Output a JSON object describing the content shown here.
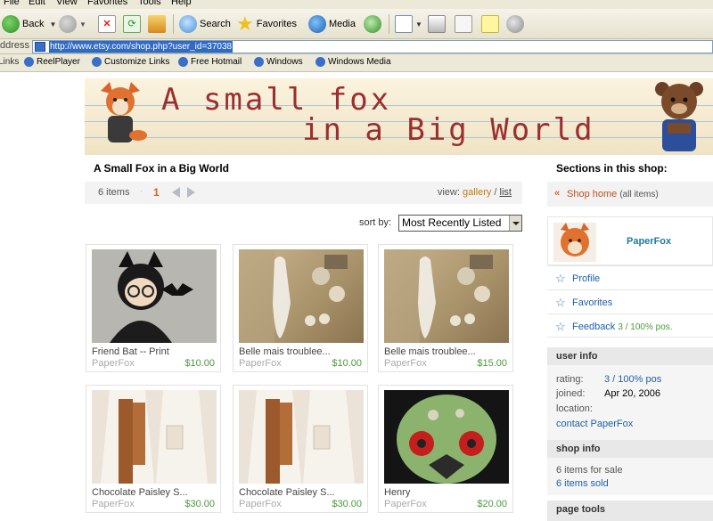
{
  "browser": {
    "menu": [
      "File",
      "Edit",
      "View",
      "Favorites",
      "Tools",
      "Help"
    ],
    "toolbar": {
      "back": "Back",
      "search": "Search",
      "favorites": "Favorites",
      "media": "Media"
    },
    "address_label": "ddress",
    "url": "http://www.etsy.com/shop.php?user_id=37038",
    "links_label": "Links",
    "links": [
      "ReelPlayer",
      "Customize Links",
      "Free Hotmail",
      "Windows",
      "Windows Media"
    ]
  },
  "banner": {
    "line1": "A small fox",
    "line2": "in a Big World"
  },
  "shop": {
    "title": "A Small Fox in a Big World",
    "items_count": "6 items",
    "page_current": "1",
    "view_label": "view:",
    "view_gallery": "gallery",
    "view_sep": "/",
    "view_list": "list",
    "sort_label": "sort by:",
    "sort_selected": "Most Recently Listed"
  },
  "items": [
    {
      "name": "Friend Bat -- Print",
      "seller": "PaperFox",
      "price": "$10.00"
    },
    {
      "name": "Belle mais troublee...",
      "seller": "PaperFox",
      "price": "$10.00"
    },
    {
      "name": "Belle mais troublee...",
      "seller": "PaperFox",
      "price": "$15.00"
    },
    {
      "name": "Chocolate Paisley S...",
      "seller": "PaperFox",
      "price": "$30.00"
    },
    {
      "name": "Chocolate Paisley S...",
      "seller": "PaperFox",
      "price": "$30.00"
    },
    {
      "name": "Henry",
      "seller": "PaperFox",
      "price": "$20.00"
    }
  ],
  "sidebar": {
    "sections_title": "Sections in this shop:",
    "shop_home": "Shop home",
    "all_items": "(all items)",
    "owner": "PaperFox",
    "profile": "Profile",
    "favorites": "Favorites",
    "feedback": "Feedback",
    "feedback_stats": "3 / 100% pos.",
    "user_info_header": "user info",
    "rating_label": "rating:",
    "rating_value": "3 / 100% pos",
    "joined_label": "joined:",
    "joined_value": "Apr 20, 2006",
    "location_label": "location:",
    "contact": "contact PaperFox",
    "shop_info_header": "shop info",
    "for_sale": "6 items for sale",
    "sold": "6 items sold",
    "page_tools_header": "page tools"
  },
  "colors": {
    "accent_orange": "#e35f1c",
    "link_blue": "#1f5fa8",
    "price_green": "#4a9a3a"
  }
}
